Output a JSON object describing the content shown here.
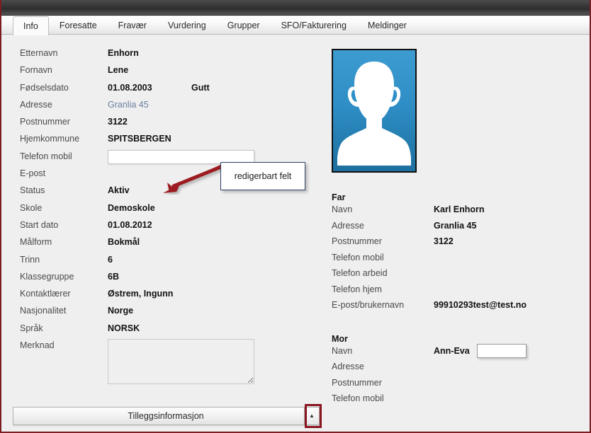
{
  "window": {
    "title": ""
  },
  "tabs": [
    {
      "label": "Info",
      "active": true
    },
    {
      "label": "Foresatte",
      "active": false
    },
    {
      "label": "Fravær",
      "active": false
    },
    {
      "label": "Vurdering",
      "active": false
    },
    {
      "label": "Grupper",
      "active": false
    },
    {
      "label": "SFO/Fakturering",
      "active": false
    },
    {
      "label": "Meldinger",
      "active": false
    }
  ],
  "student": {
    "fields": [
      {
        "label": "Etternavn",
        "value": "Enhorn",
        "type": "text"
      },
      {
        "label": "Fornavn",
        "value": "Lene",
        "type": "text"
      },
      {
        "label": "Fødselsdato",
        "value": "01.08.2003",
        "type": "text",
        "extra": "Gutt"
      },
      {
        "label": "Adresse",
        "value": "Granlia 45",
        "type": "link"
      },
      {
        "label": "Postnummer",
        "value": "3122",
        "type": "text"
      },
      {
        "label": "Hjemkommune",
        "value": "SPITSBERGEN",
        "type": "text"
      },
      {
        "label": "Telefon mobil",
        "value": "",
        "type": "input"
      },
      {
        "label": "E-post",
        "value": "",
        "type": "text"
      },
      {
        "label": "Status",
        "value": "Aktiv",
        "type": "text"
      },
      {
        "label": "Skole",
        "value": "Demoskole",
        "type": "text"
      },
      {
        "label": "Start dato",
        "value": "01.08.2012",
        "type": "text"
      },
      {
        "label": "Målform",
        "value": "Bokmål",
        "type": "text"
      },
      {
        "label": "Trinn",
        "value": "6",
        "type": "text"
      },
      {
        "label": "Klassegruppe",
        "value": "6B",
        "type": "text"
      },
      {
        "label": "Kontaktlærer",
        "value": "Østrem, Ingunn",
        "type": "text"
      },
      {
        "label": "Nasjonalitet",
        "value": "Norge",
        "type": "text"
      },
      {
        "label": "Språk",
        "value": "NORSK",
        "type": "text"
      },
      {
        "label": "Merknad",
        "value": "",
        "type": "memo"
      }
    ]
  },
  "photo": {
    "alt": "person-silhouette",
    "bg_top": "#3d9bd0",
    "bg_bottom": "#1d6f9f",
    "silhouette_color": "#ffffff"
  },
  "father": {
    "title": "Far",
    "fields": [
      {
        "label": "Navn",
        "value": "Karl Enhorn"
      },
      {
        "label": "Adresse",
        "value": "Granlia 45"
      },
      {
        "label": "Postnummer",
        "value": "3122"
      },
      {
        "label": "Telefon mobil",
        "value": ""
      },
      {
        "label": "Telefon arbeid",
        "value": ""
      },
      {
        "label": "Telefon hjem",
        "value": ""
      },
      {
        "label": "E-post/brukernavn",
        "value": "99910293test@test.no"
      }
    ]
  },
  "mother": {
    "title": "Mor",
    "name_label": "Navn",
    "name_value": "Ann-Eva",
    "name_input_value": "",
    "fields": [
      {
        "label": "Adresse",
        "value": ""
      },
      {
        "label": "Postnummer",
        "value": ""
      },
      {
        "label": "Telefon mobil",
        "value": ""
      }
    ]
  },
  "callout": {
    "text": "redigerbart felt",
    "arrow_color": "#9c1c21",
    "border_color": "#2f3f63"
  },
  "accordion": {
    "label": "Tilleggsinformasjon",
    "chevron": "▲",
    "highlight_color": "#8a1720"
  }
}
